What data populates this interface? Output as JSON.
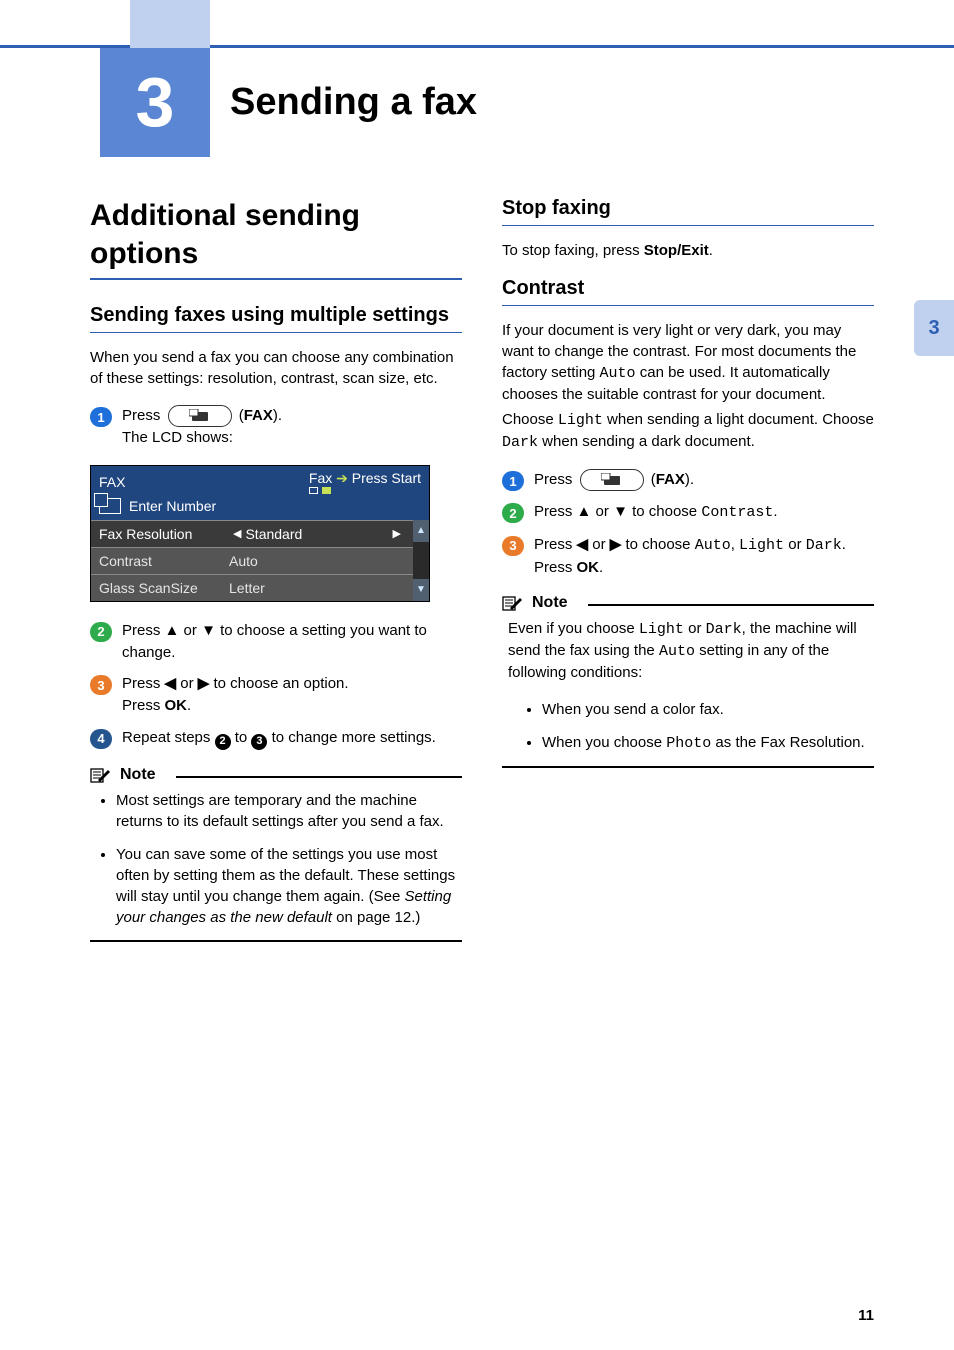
{
  "chapter": {
    "number": "3",
    "title": "Sending a fax"
  },
  "side_tab": "3",
  "page_number": "11",
  "left": {
    "h1": "Additional sending options",
    "h2": "Sending faxes using multiple settings",
    "intro": "When you send a fax you can choose any combination of these settings: resolution, contrast, scan size, etc.",
    "steps": {
      "s1_pre": "Press ",
      "s1_post": " (",
      "s1_bold": "FAX",
      "s1_end": ").",
      "s1_line2": "The LCD shows:",
      "s2_a": "Press ",
      "s2_up": "▲",
      "s2_or": " or ",
      "s2_dn": "▼",
      "s2_b": " to choose a setting you want to change.",
      "s3_a": "Press ",
      "s3_l": "◀",
      "s3_or": " or ",
      "s3_r": "▶",
      "s3_b": " to choose an option.",
      "s3_c": "Press ",
      "s3_ok": "OK",
      "s3_d": ".",
      "s4_a": "Repeat steps ",
      "s4_ref2": "2",
      "s4_mid": " to ",
      "s4_ref3": "3",
      "s4_b": " to change more settings."
    },
    "lcd": {
      "top_left": "FAX",
      "top_right_a": "Fax ",
      "top_right_arrow": "➔",
      "top_right_b": " Press Start",
      "mid": "Enter Number",
      "rows": [
        {
          "label": "Fax Resolution",
          "value": "Standard",
          "active": true
        },
        {
          "label": "Contrast",
          "value": "Auto",
          "active": false
        },
        {
          "label": "Glass ScanSize",
          "value": "Letter",
          "active": false
        }
      ]
    },
    "note": {
      "label": "Note",
      "b1": "Most settings are temporary and the machine returns to its default settings after you send a fax.",
      "b2_a": "You can save some of the settings you use most often by setting them as the default. These settings will stay until you change them again. (See ",
      "b2_i": "Setting your changes as the new default",
      "b2_b": " on page 12.)"
    }
  },
  "right": {
    "stop": {
      "title": "Stop faxing",
      "text_a": "To stop faxing, press ",
      "text_bold": "Stop/Exit",
      "text_b": "."
    },
    "contrast": {
      "title": "Contrast",
      "para_a": "If your document is very light or very dark, you may want to change the contrast. For most documents the factory setting ",
      "para_auto": "Auto",
      "para_b": " can be used. It automatically chooses the suitable contrast for your document.",
      "para_c": "Choose ",
      "para_light": "Light",
      "para_d": " when sending a light document. Choose ",
      "para_dark": "Dark",
      "para_e": " when sending a dark document.",
      "steps": {
        "s1_pre": "Press ",
        "s1_post": " (",
        "s1_bold": "FAX",
        "s1_end": ").",
        "s2_a": "Press ",
        "s2_up": "▲",
        "s2_or": " or ",
        "s2_dn": "▼",
        "s2_b": " to choose ",
        "s2_mono": "Contrast",
        "s2_c": ".",
        "s3_a": "Press ",
        "s3_l": "◀",
        "s3_or": " or ",
        "s3_r": "▶",
        "s3_b": " to choose ",
        "s3_m1": "Auto",
        "s3_comma": ", ",
        "s3_m2": "Light",
        "s3_or2": " or ",
        "s3_m3": "Dark",
        "s3_c": ".",
        "s3_d": "Press ",
        "s3_ok": "OK",
        "s3_e": "."
      },
      "note": {
        "label": "Note",
        "lead_a": "Even if you choose ",
        "lead_m1": "Light",
        "lead_or": " or ",
        "lead_m2": "Dark",
        "lead_b": ", the machine will send the fax using the ",
        "lead_m3": "Auto",
        "lead_c": " setting in any of the following conditions:",
        "b1": "When you send a color fax.",
        "b2_a": "When you choose ",
        "b2_m": "Photo",
        "b2_b": " as the Fax Resolution."
      }
    }
  }
}
